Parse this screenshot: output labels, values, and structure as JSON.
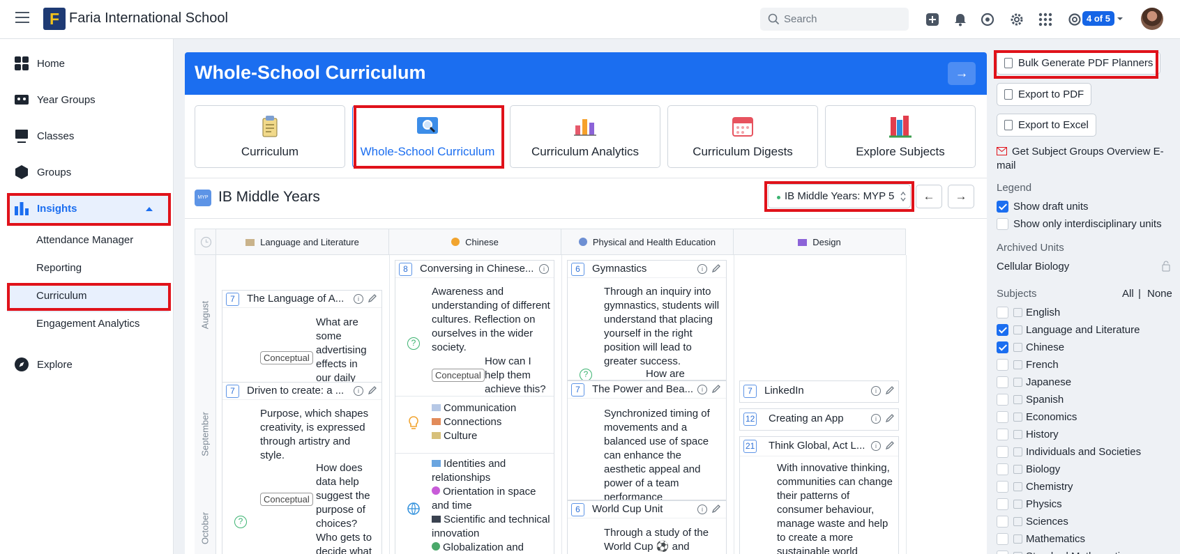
{
  "header": {
    "school_name": "Faria International School",
    "logo_letter": "F",
    "search_placeholder": "Search",
    "badge": "4 of 5"
  },
  "sidebar": {
    "items": [
      {
        "label": "Home"
      },
      {
        "label": "Year Groups"
      },
      {
        "label": "Classes"
      },
      {
        "label": "Groups"
      },
      {
        "label": "Insights"
      },
      {
        "label": "Explore"
      }
    ],
    "insights_sub": [
      {
        "label": "Attendance Manager"
      },
      {
        "label": "Reporting"
      },
      {
        "label": "Curriculum"
      },
      {
        "label": "Engagement Analytics"
      }
    ]
  },
  "main": {
    "title": "Whole-School Curriculum",
    "tabs": [
      {
        "label": "Curriculum"
      },
      {
        "label": "Whole-School Curriculum"
      },
      {
        "label": "Curriculum Analytics"
      },
      {
        "label": "Curriculum Digests"
      },
      {
        "label": "Explore Subjects"
      }
    ],
    "programme_title": "IB Middle Years",
    "programme_icon": "MYP",
    "selector_value": "IB Middle Years: MYP 5",
    "columns": [
      "Language and Literature",
      "Chinese",
      "Physical and Health Education",
      "Design"
    ],
    "months": [
      "August",
      "September",
      "October"
    ],
    "cards": {
      "c1": {
        "num": "7",
        "title": "The Language of A...",
        "body": "What are some advertising effects in our daily",
        "tag": "Conceptual"
      },
      "c2": {
        "num": "7",
        "title": "Driven to create: a ...",
        "body": "Purpose, which shapes creativity, is expressed through artistry and style.",
        "q": "How does data help suggest the purpose of choices? Who gets to decide what",
        "tag": "Conceptual"
      },
      "c3": {
        "num": "8",
        "title": "Conversing in Chinese...",
        "body": "Awareness and understanding of different cultures. Reflection on ourselves in the wider society.",
        "q": "How can I help them achieve this?",
        "tag": "Conceptual",
        "concepts": [
          "Communication",
          "Connections",
          "Culture"
        ],
        "contexts": [
          "Identities and relationships",
          "Orientation in space and time",
          "Scientific and technical innovation",
          "Globalization and"
        ]
      },
      "c4": {
        "num": "6",
        "title": "Gymnastics",
        "body": "Through an inquiry into gymnastics, students will understand that placing yourself in the right position will lead to greater success.",
        "q": "How are"
      },
      "c5": {
        "num": "7",
        "title": "The Power and Bea...",
        "body": "Synchronized timing of movements and a balanced use of space can enhance the aesthetic appeal and power of a team performance"
      },
      "c6": {
        "num": "6",
        "title": "World Cup Unit",
        "body": "Through a study of the World Cup ⚽ and"
      },
      "c7": {
        "num": "7",
        "title": "LinkedIn"
      },
      "c8": {
        "num": "12",
        "title": "Creating an App"
      },
      "c9": {
        "num": "21",
        "title": "Think Global, Act L...",
        "body": "With innovative thinking, communities can change their patterns of consumer behaviour, manage waste and help to create a more sustainable world"
      }
    }
  },
  "right_panel": {
    "bulk": "Bulk Generate PDF Planners",
    "export_pdf": "Export to PDF",
    "export_excel": "Export to Excel",
    "email": "Get Subject Groups Overview E-mail",
    "legend": "Legend",
    "show_draft": "Show draft units",
    "show_interdisc": "Show only interdisciplinary units",
    "archived": "Archived Units",
    "archived_item": "Cellular Biology",
    "subjects": "Subjects",
    "all": "All",
    "pipe": "|",
    "none": "None",
    "subject_list": [
      {
        "name": "English",
        "checked": false
      },
      {
        "name": "Language and Literature",
        "checked": true
      },
      {
        "name": "Chinese",
        "checked": true
      },
      {
        "name": "French",
        "checked": false
      },
      {
        "name": "Japanese",
        "checked": false
      },
      {
        "name": "Spanish",
        "checked": false
      },
      {
        "name": "Economics",
        "checked": false
      },
      {
        "name": "History",
        "checked": false
      },
      {
        "name": "Individuals and Societies",
        "checked": false
      },
      {
        "name": "Biology",
        "checked": false
      },
      {
        "name": "Chemistry",
        "checked": false
      },
      {
        "name": "Physics",
        "checked": false
      },
      {
        "name": "Sciences",
        "checked": false
      },
      {
        "name": "Mathematics",
        "checked": false
      },
      {
        "name": "Standard Mathematics",
        "checked": false
      }
    ]
  },
  "colors": {
    "accent": "#1b6ef0",
    "highlight": "#e0121a"
  }
}
